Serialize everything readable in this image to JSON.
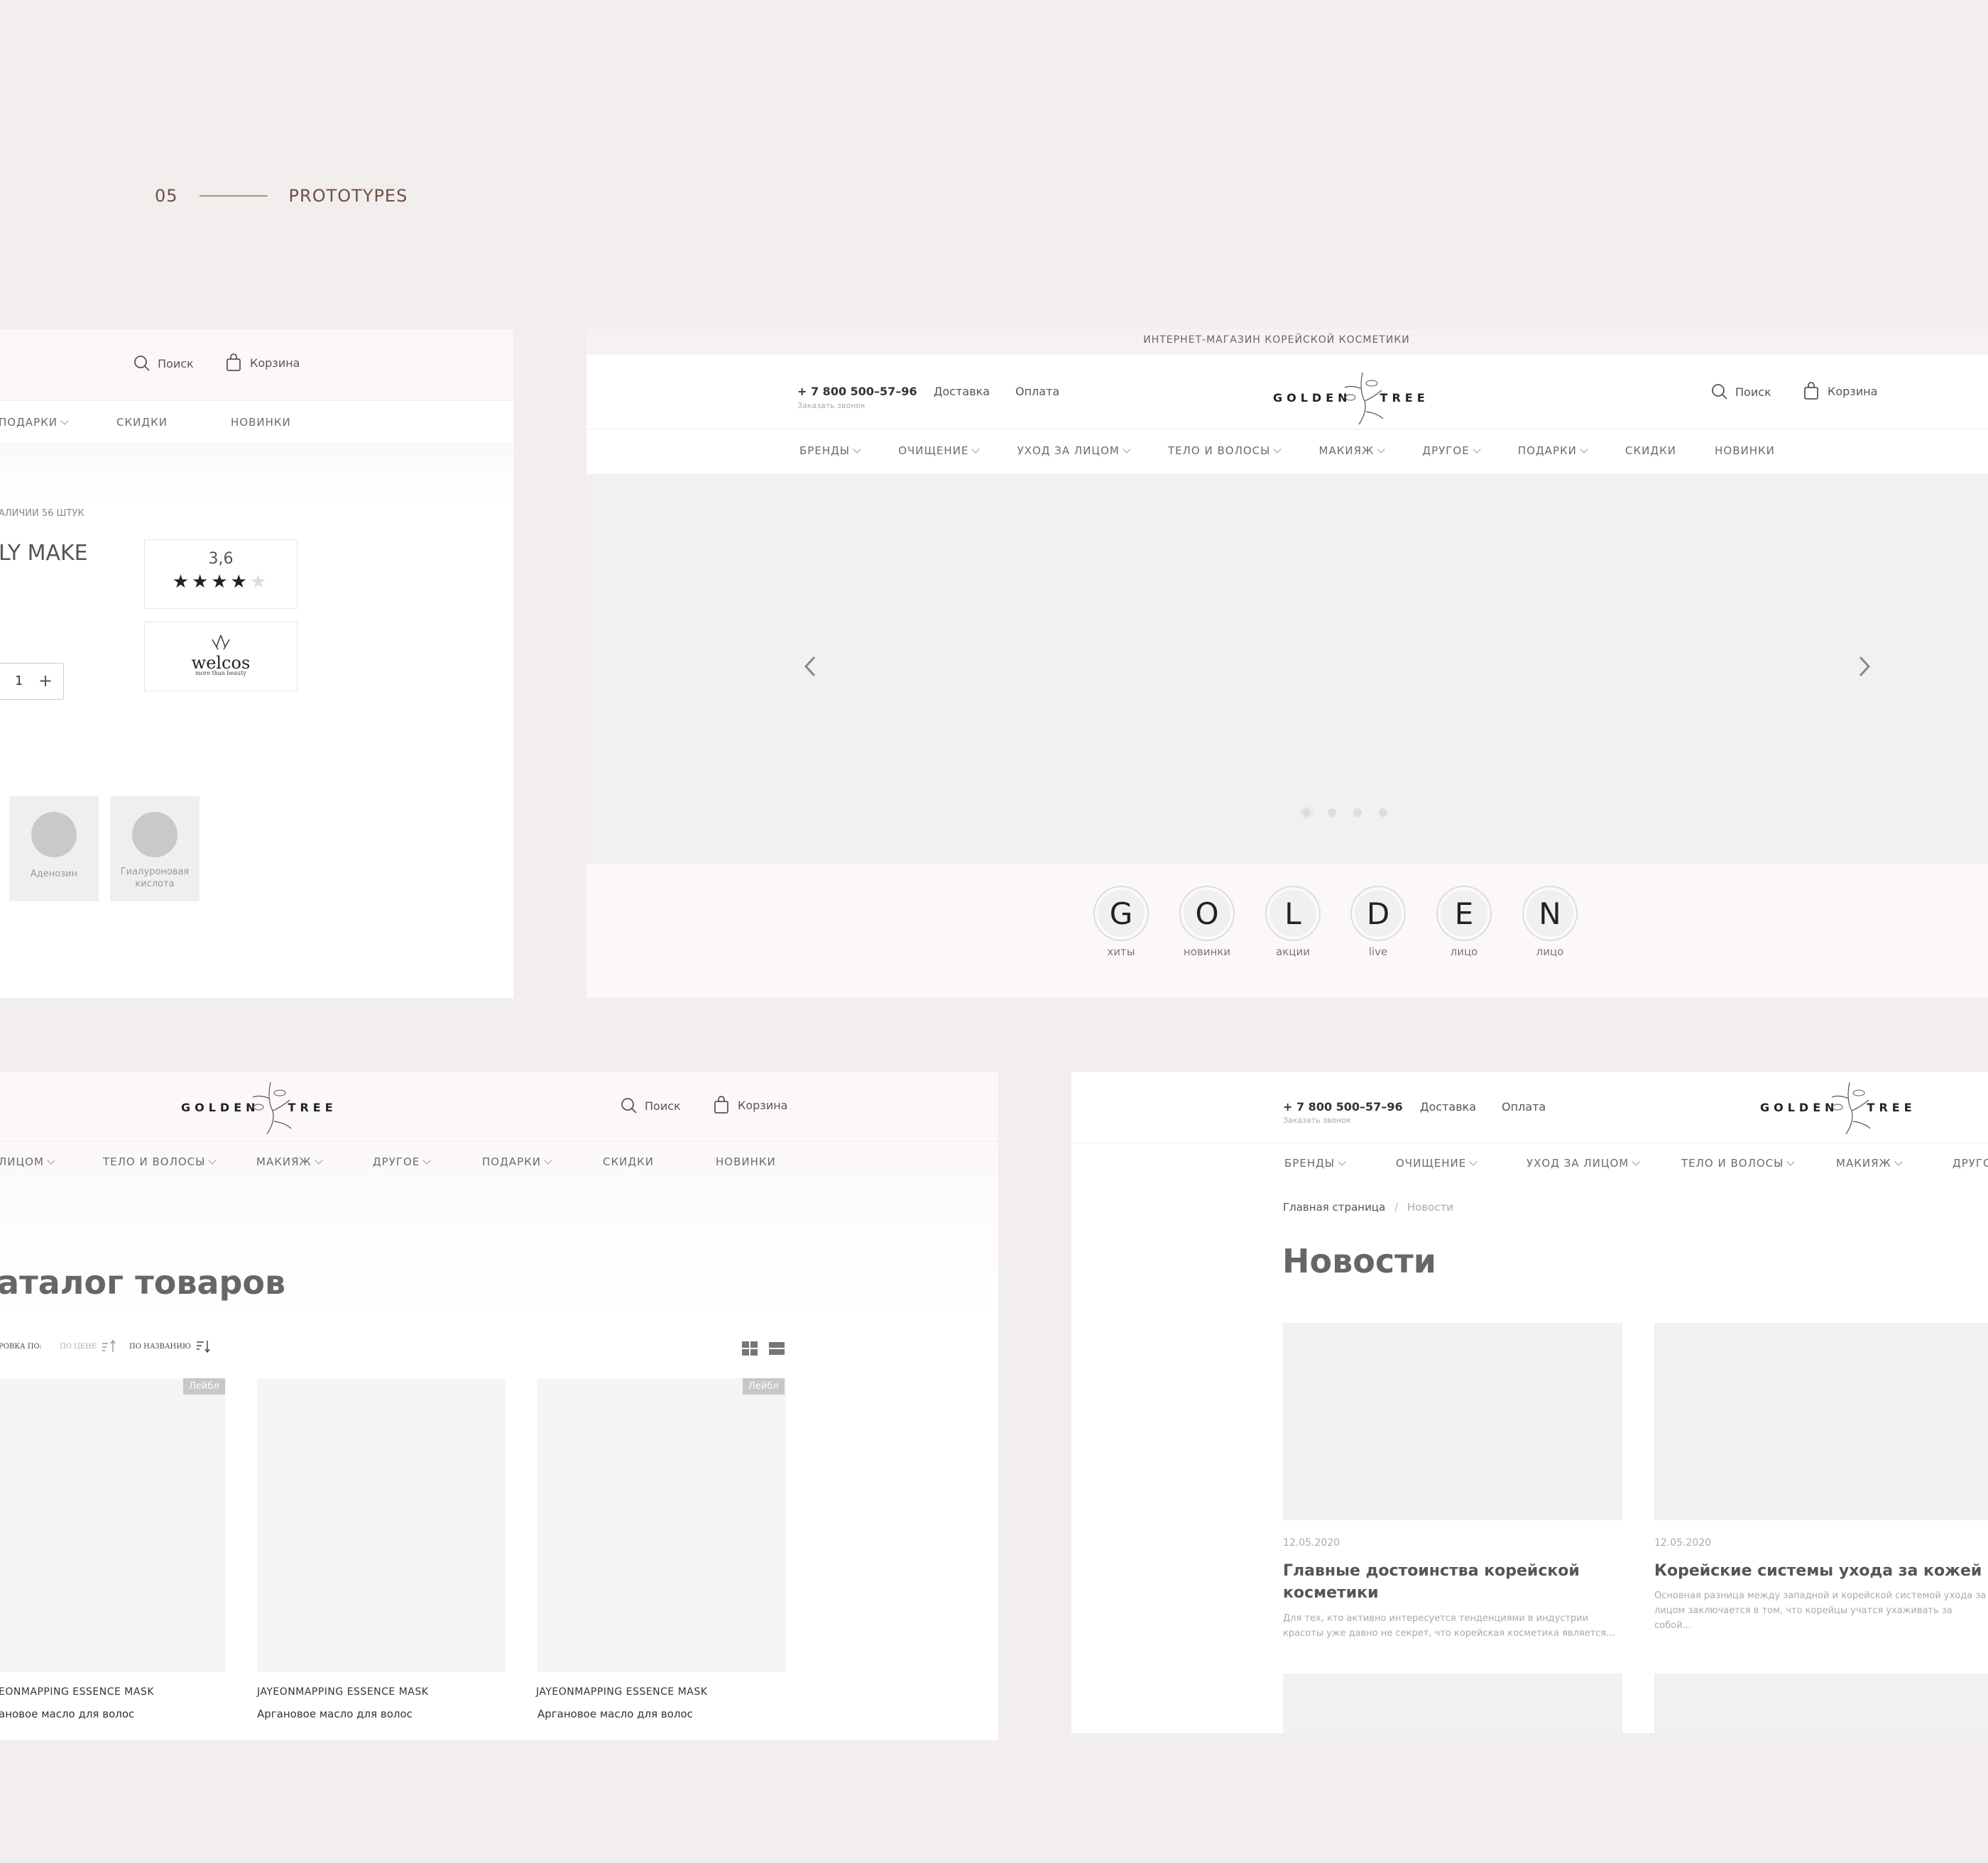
{
  "section": {
    "number": "05",
    "title": "PROTOTYPES"
  },
  "product_panel": {
    "search": "Поиск",
    "cart": "Корзина",
    "nav": [
      "ПОДАРКИ",
      "СКИДКИ",
      "НОВИНКИ"
    ],
    "stock": "АЛИЧИИ 56 ШТУК",
    "title": "LY MAKE",
    "rating": "3,6",
    "rating_stars": 4,
    "quantity": "1",
    "plus": "+",
    "brand_logo": "welcos",
    "brand_tagline": "more than beauty",
    "ingredients": [
      "Аденозин",
      "Гиалуроновая кислота"
    ]
  },
  "home_panel": {
    "topbar": "ИНТЕРНЕТ-МАГАЗИН КОРЕЙСКОЙ КОСМЕТИКИ",
    "phone": "+ 7 800 500–57–96",
    "callback": "Заказать звонок",
    "delivery": "Доставка",
    "payment": "Оплата",
    "logo_left": "GOLDEN",
    "logo_right": "TREE",
    "search": "Поиск",
    "cart": "Корзина",
    "nav": [
      {
        "label": "БРЕНДЫ",
        "chev": true
      },
      {
        "label": "ОЧИЩЕНИЕ",
        "chev": true
      },
      {
        "label": "УХОД ЗА ЛИЦОМ",
        "chev": true
      },
      {
        "label": "ТЕЛО И ВОЛОСЫ",
        "chev": true
      },
      {
        "label": "МАКИЯЖ",
        "chev": true
      },
      {
        "label": "ДРУГОЕ",
        "chev": true
      },
      {
        "label": "ПОДАРКИ",
        "chev": true
      },
      {
        "label": "СКИДКИ",
        "chev": false
      },
      {
        "label": "НОВИНКИ",
        "chev": false
      }
    ],
    "slider_dots": 4,
    "circles": [
      {
        "letter": "G",
        "label": "хиты"
      },
      {
        "letter": "O",
        "label": "новинки"
      },
      {
        "letter": "L",
        "label": "акции"
      },
      {
        "letter": "D",
        "label": "live"
      },
      {
        "letter": "E",
        "label": "лицо"
      },
      {
        "letter": "N",
        "label": "лицо"
      }
    ]
  },
  "catalog_panel": {
    "logo_left": "GOLDEN",
    "logo_right": "TREE",
    "search": "Поиск",
    "cart": "Корзина",
    "nav": [
      {
        "label": "ЛИЦОМ",
        "chev": true
      },
      {
        "label": "ТЕЛО И ВОЛОСЫ",
        "chev": true
      },
      {
        "label": "МАКИЯЖ",
        "chev": true
      },
      {
        "label": "ДРУГОЕ",
        "chev": true
      },
      {
        "label": "ПОДАРКИ",
        "chev": true
      },
      {
        "label": "СКИДКИ",
        "chev": false
      },
      {
        "label": "НОВИНКИ",
        "chev": false
      }
    ],
    "title": "аталог товаров",
    "sort_label": "РОВКА ПО:",
    "sort_price": "ПО ЦЕНЕ",
    "sort_name": "ПО НАЗВАНИЮ",
    "products": [
      {
        "badge": "Лейбл",
        "brand": "EONMAPPING ESSENCE MASK",
        "name": "ановое масло для волос"
      },
      {
        "badge": "",
        "brand": "JAYEONMAPPING ESSENCE MASK",
        "name": "Аргановое масло для волос"
      },
      {
        "badge": "Лейбл",
        "brand": "JAYEONMAPPING ESSENCE MASK",
        "name": "Аргановое масло для волос"
      }
    ]
  },
  "news_panel": {
    "phone": "+ 7 800 500–57–96",
    "callback": "Заказать звонок",
    "delivery": "Доставка",
    "payment": "Оплата",
    "logo_left": "GOLDEN",
    "logo_right": "TREE",
    "nav": [
      {
        "label": "БРЕНДЫ",
        "chev": true
      },
      {
        "label": "ОЧИЩЕНИЕ",
        "chev": true
      },
      {
        "label": "УХОД ЗА ЛИЦОМ",
        "chev": true
      },
      {
        "label": "ТЕЛО И ВОЛОСЫ",
        "chev": true
      },
      {
        "label": "МАКИЯЖ",
        "chev": true
      },
      {
        "label": "ДРУГО",
        "chev": false
      }
    ],
    "breadcrumb_home": "Главная страница",
    "breadcrumb_sep": "/",
    "breadcrumb_current": "Новости",
    "title": "Новости",
    "articles": [
      {
        "date": "12.05.2020",
        "title": "Главные достоинства корейской косметики",
        "text": "Для тех, кто активно интересуется тенденциями в индустрии красоты уже давно не секрет, что корейская косметика является..."
      },
      {
        "date": "12.05.2020",
        "title": "Корейские системы ухода за кожей",
        "text": "Основная разница между западной и корейской системой ухода за лицом заключается в том, что корейцы учатся ухаживать за собой..."
      }
    ]
  }
}
